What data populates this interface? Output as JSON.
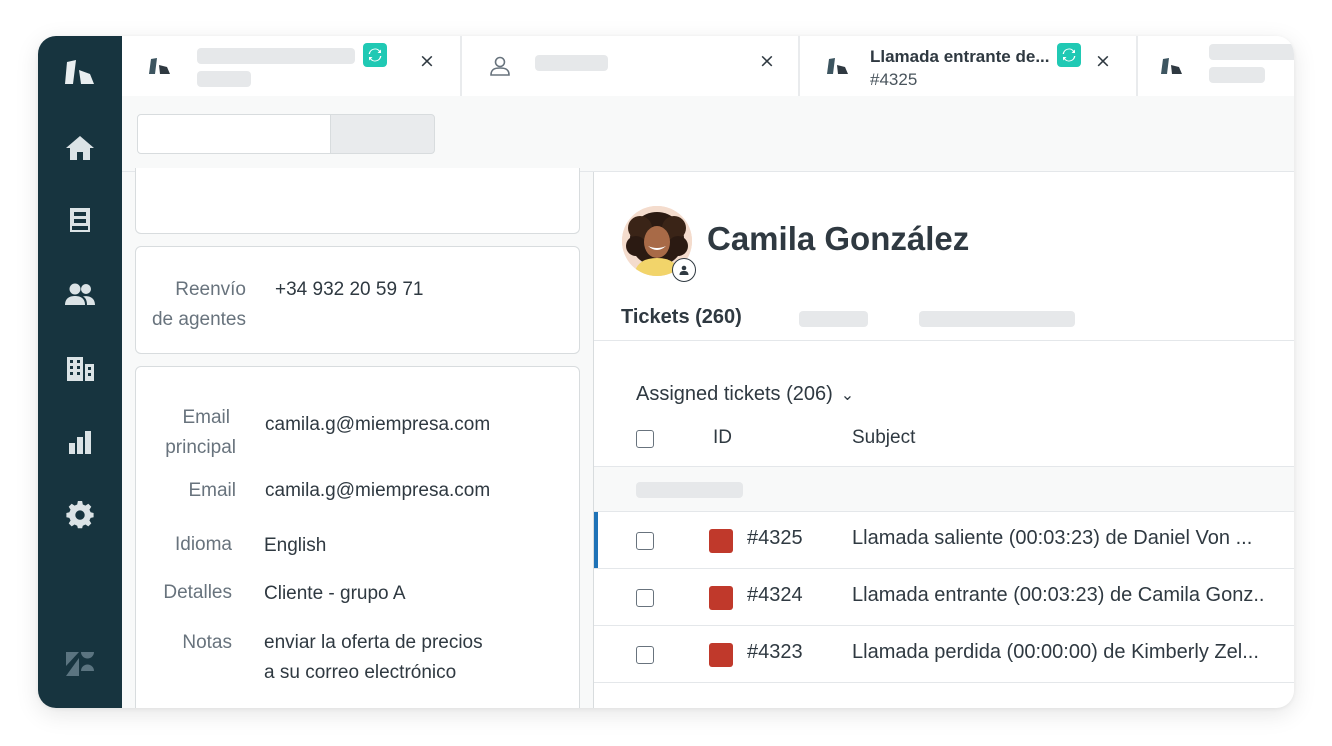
{
  "tabs": [
    {
      "title": "",
      "subtitle": ""
    },
    {
      "title": "",
      "subtitle": ""
    },
    {
      "title": "Llamada entrante de...",
      "subtitle": "#4325"
    },
    {
      "title": "",
      "subtitle": ""
    }
  ],
  "close_glyph": "×",
  "sidebar": {
    "items": [
      "logo-icon",
      "home-icon",
      "views-icon",
      "customers-icon",
      "organizations-icon",
      "reporting-icon",
      "admin-gear-icon",
      "zendesk-icon"
    ]
  },
  "user_details": {
    "forwarding": {
      "label_line1": "Reenvío",
      "label_line2": "de agentes",
      "value": "+34 932 20 59 71"
    },
    "fields": [
      {
        "label_line1": "Email",
        "label_line2": "principal",
        "value": "camila.g@miempresa.com"
      },
      {
        "label": "Email",
        "value": "camila.g@miempresa.com"
      },
      {
        "label": "Idioma",
        "value": "English"
      },
      {
        "label": "Detalles",
        "value": "Cliente - grupo A"
      },
      {
        "label": "Notas",
        "value_line1": "enviar la oferta de precios",
        "value_line2": "a su correo electrónico"
      }
    ]
  },
  "profile": {
    "name": "Camila González",
    "tab_active": "Tickets (260)"
  },
  "tickets": {
    "filter_label": "Assigned tickets (206)",
    "columns": {
      "id": "ID",
      "subject": "Subject"
    },
    "rows": [
      {
        "id": "#4325",
        "subject": "Llamada saliente (00:03:23) de Daniel Von ...",
        "status_color": "#c0392b",
        "active": true
      },
      {
        "id": "#4324",
        "subject": "Llamada entrante (00:03:23) de Camila Gonz..",
        "status_color": "#c0392b",
        "active": false
      },
      {
        "id": "#4323",
        "subject": "Llamada perdida (00:00:00) de Kimberly Zel...",
        "status_color": "#c0392b",
        "active": false
      }
    ]
  },
  "colors": {
    "sidebar": "#17343f",
    "badge": "#20c9b4",
    "status_open": "#c0392b",
    "active_row": "#1f73b7"
  }
}
